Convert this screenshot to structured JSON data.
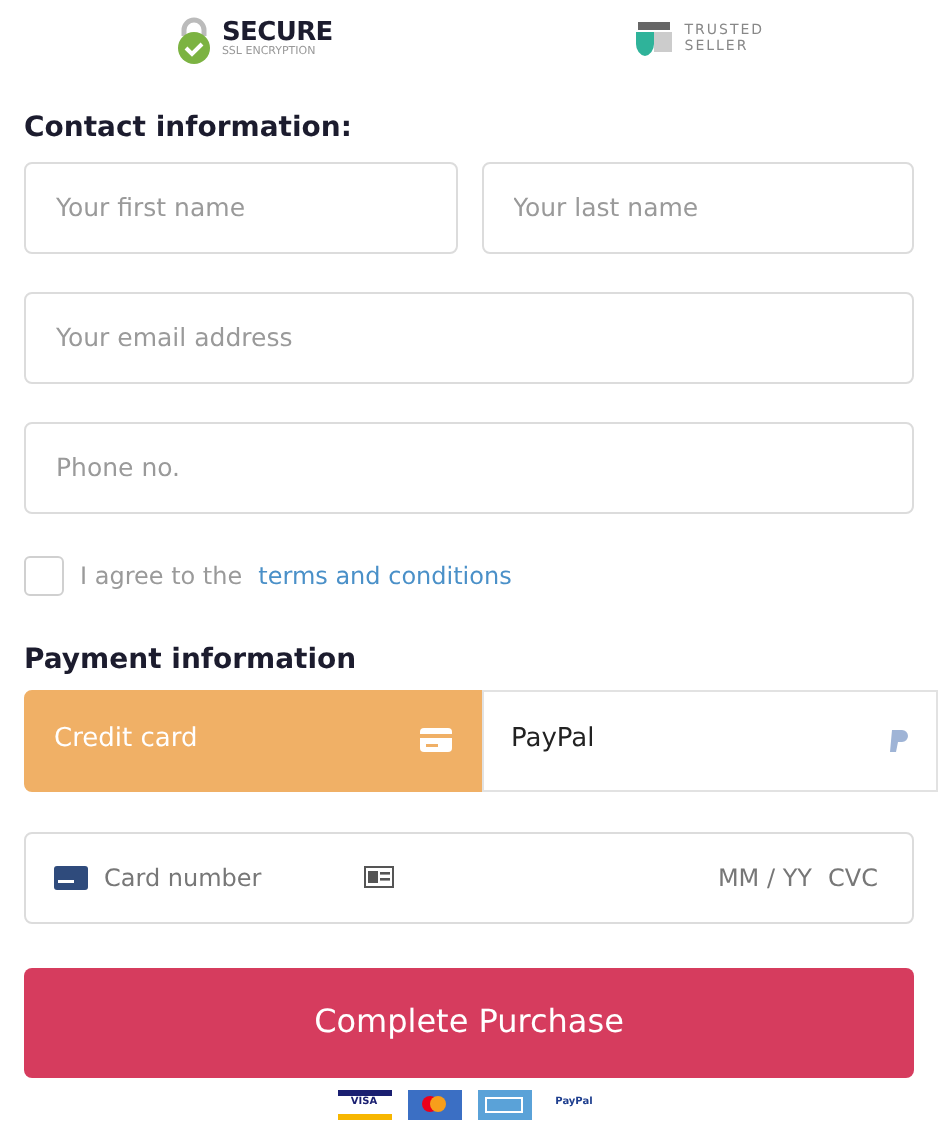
{
  "badges": [
    {
      "kind": "secure",
      "title": "SECURE",
      "subtitle": "SSL ENCRYPTION"
    },
    {
      "kind": "trusted",
      "title": "TRUSTED",
      "subtitle": "SELLER"
    }
  ],
  "contact": {
    "heading": "Contact information:",
    "fields": [
      {
        "placeholder": "Your first name",
        "half": true
      },
      {
        "placeholder": "Your last name",
        "half": true
      },
      {
        "placeholder": "Your email address",
        "half": false
      },
      {
        "placeholder": "Phone no.",
        "half": false
      }
    ],
    "agree": {
      "checked": false,
      "text": "I agree to the",
      "link": "terms and conditions"
    }
  },
  "payment": {
    "heading": "Payment information",
    "methods": [
      {
        "label": "Credit card",
        "kind": "card",
        "selected": true
      },
      {
        "label": "PayPal",
        "kind": "paypal",
        "selected": false
      }
    ],
    "card": {
      "number_placeholder": "Card number",
      "expiry_placeholder": "MM / YY",
      "cvc_placeholder": "CVC"
    },
    "submit": "Complete Purchase",
    "logos": [
      {
        "kind": "visa",
        "label": "VISA"
      },
      {
        "kind": "mastercard"
      },
      {
        "kind": "amex"
      },
      {
        "kind": "paypal",
        "label": "PayPal"
      }
    ]
  }
}
